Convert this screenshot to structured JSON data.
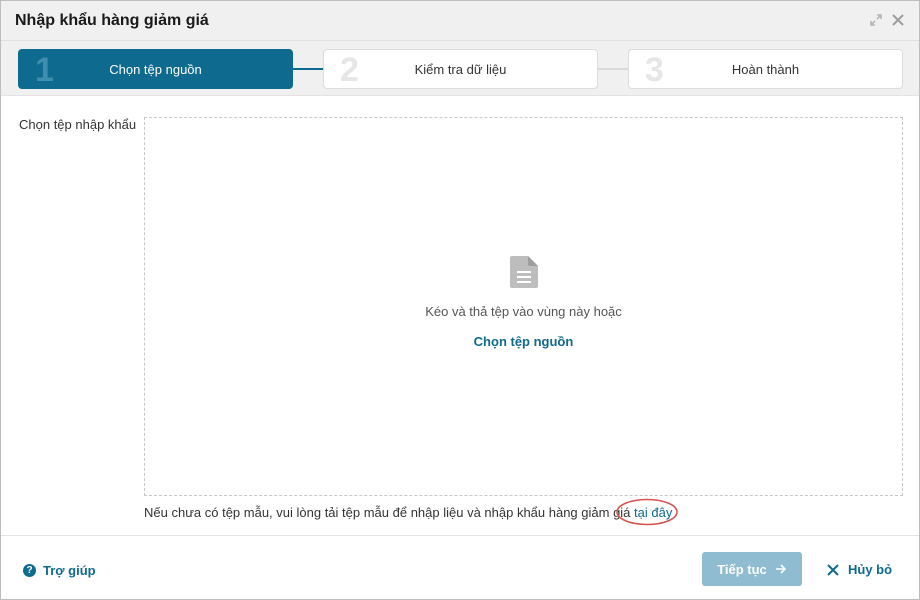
{
  "dialog": {
    "title": "Nhập khẩu hàng giảm giá"
  },
  "steps": [
    {
      "number": "1",
      "label": "Chọn tệp nguồn",
      "active": true
    },
    {
      "number": "2",
      "label": "Kiểm tra dữ liệu",
      "active": false
    },
    {
      "number": "3",
      "label": "Hoàn thành",
      "active": false
    }
  ],
  "form": {
    "field_label": "Chọn tệp nhập khẩu",
    "dropzone_text": "Kéo và thả tệp vào vùng này hoặc",
    "dropzone_link": "Chọn tệp nguồn",
    "note_text": "Nếu chưa có tệp mẫu, vui lòng tải tệp mẫu để nhập liệu và nhập khẩu hàng giảm giá",
    "note_link": "tại đây"
  },
  "footer": {
    "help_label": "Trợ giúp",
    "next_label": "Tiếp tục",
    "cancel_label": "Hủy bỏ"
  },
  "colors": {
    "accent": "#0e6a8e",
    "accent_disabled": "#8fbcd0",
    "highlight_oval": "#d9534f"
  }
}
